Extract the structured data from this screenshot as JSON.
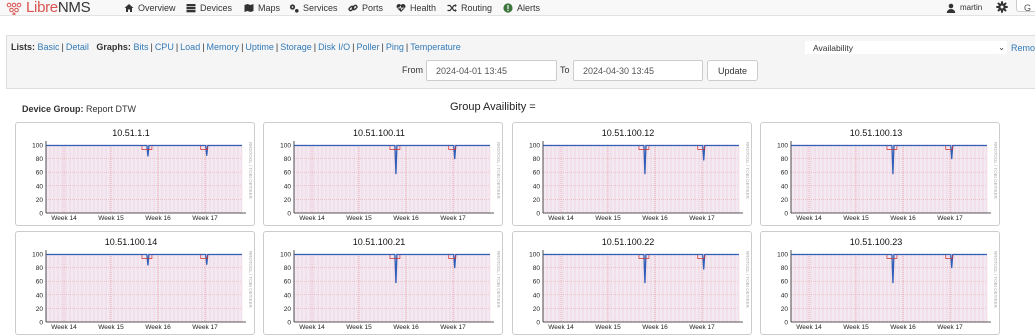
{
  "navbar": {
    "brand_prefix": "Libre",
    "brand_suffix": "NMS",
    "items": [
      {
        "label": "Overview",
        "icon": "home-icon"
      },
      {
        "label": "Devices",
        "icon": "server-icon"
      },
      {
        "label": "Maps",
        "icon": "map-icon"
      },
      {
        "label": "Services",
        "icon": "cogs-icon"
      },
      {
        "label": "Ports",
        "icon": "link-icon"
      },
      {
        "label": "Health",
        "icon": "heartbeat-icon"
      },
      {
        "label": "Routing",
        "icon": "random-icon"
      },
      {
        "label": "Alerts",
        "icon": "exclamation-circle-icon"
      }
    ],
    "user": "martin",
    "global_search_label": "G"
  },
  "filters": {
    "lists_label": "Lists:",
    "lists": [
      "Basic",
      "Detail"
    ],
    "graphs_label": "Graphs:",
    "graphs": [
      "Bits",
      "CPU",
      "Load",
      "Memory",
      "Uptime",
      "Storage",
      "Disk I/O",
      "Poller",
      "Ping",
      "Temperature"
    ],
    "selected_view": "Availability",
    "remove_label": "Remove"
  },
  "range": {
    "from_label": "From",
    "from_value": "2024-04-01 13:45",
    "to_label": "To",
    "to_value": "2024-04-30 13:45",
    "update_label": "Update"
  },
  "group": {
    "label": "Device Group:",
    "name": "Report DTW",
    "title": "Group Availibity ="
  },
  "graph_axes": {
    "y_ticks": [
      "100",
      "80",
      "60",
      "40",
      "20",
      "0"
    ],
    "x_ticks": [
      "Week 14",
      "Week 15",
      "Week 16",
      "Week 17"
    ],
    "side_label": "RRDTOOL / TOBI OETIKER"
  },
  "graphs": [
    {
      "title": "10.51.1.1"
    },
    {
      "title": "10.51.100.11"
    },
    {
      "title": "10.51.100.12"
    },
    {
      "title": "10.51.100.13"
    },
    {
      "title": "10.51.100.14"
    },
    {
      "title": "10.51.100.21"
    },
    {
      "title": "10.51.100.22"
    },
    {
      "title": "10.51.100.23"
    }
  ],
  "colors": {
    "link": "#337ab7",
    "plot_bg": "#f3e9f3",
    "grid": "#e3a3a3",
    "line_blue": "#2f5fb8",
    "line_red": "#d03030"
  }
}
